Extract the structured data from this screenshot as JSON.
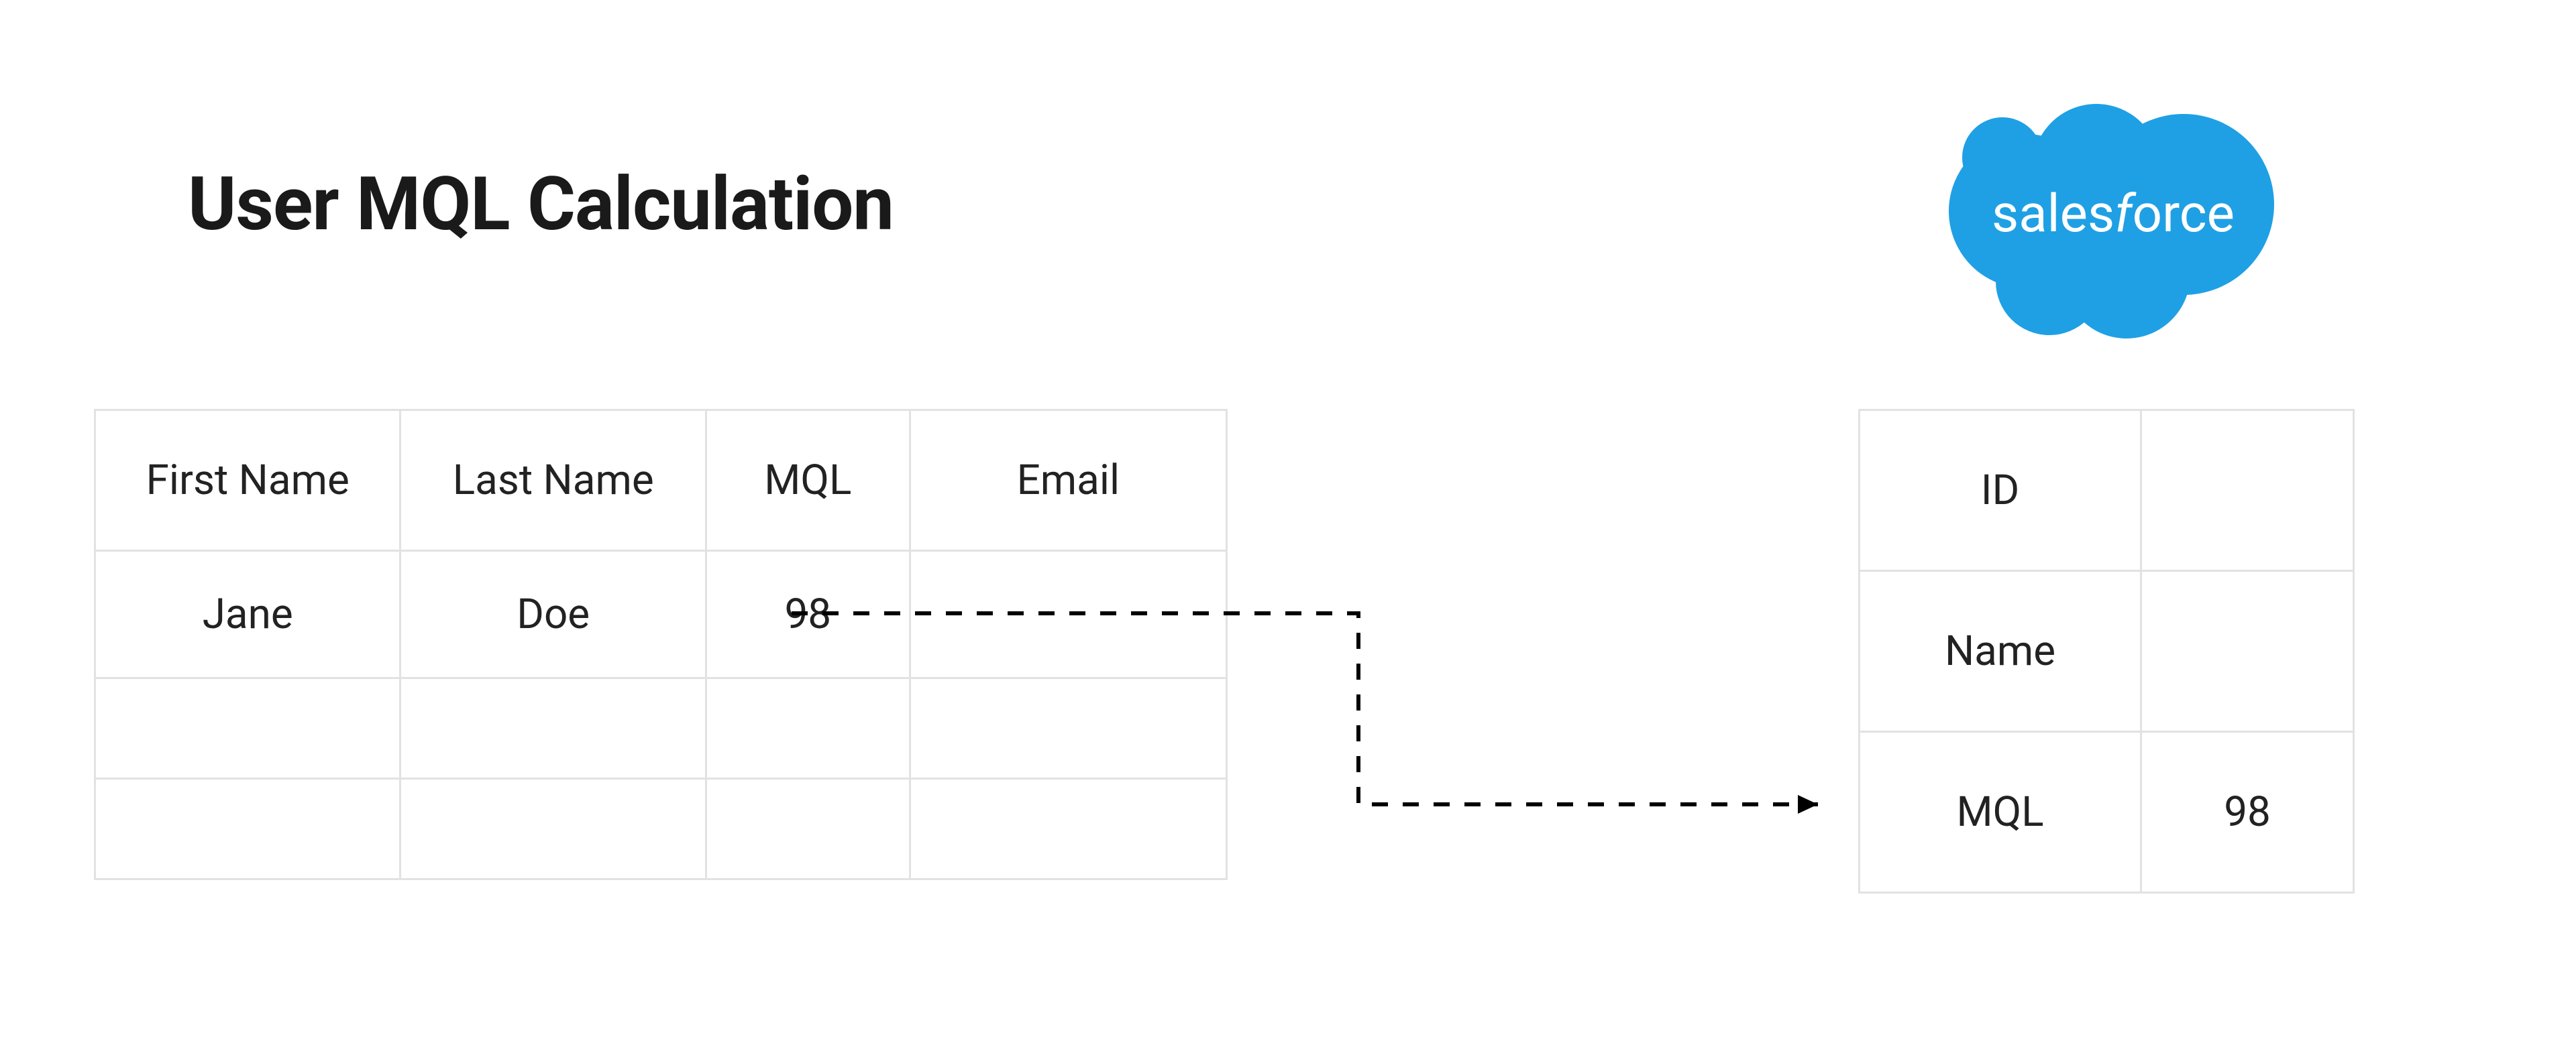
{
  "title": "User MQL Calculation",
  "logo": {
    "name": "salesforce"
  },
  "left_table": {
    "headers": [
      "First Name",
      "Last Name",
      "MQL",
      "Email"
    ],
    "rows": [
      {
        "first_name": "Jane",
        "last_name": "Doe",
        "mql": "98",
        "email": ""
      },
      {
        "first_name": "",
        "last_name": "",
        "mql": "",
        "email": ""
      },
      {
        "first_name": "",
        "last_name": "",
        "mql": "",
        "email": ""
      }
    ]
  },
  "right_table": {
    "rows": [
      {
        "label": "ID",
        "value": ""
      },
      {
        "label": "Name",
        "value": ""
      },
      {
        "label": "MQL",
        "value": "98"
      }
    ]
  }
}
